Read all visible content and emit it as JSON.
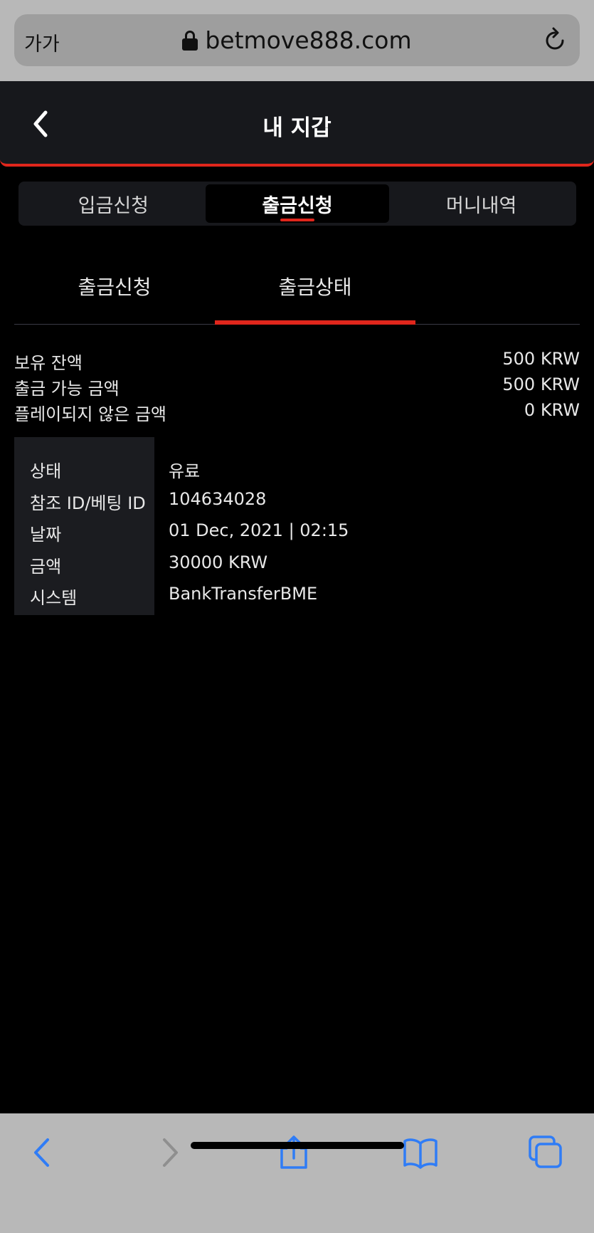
{
  "browser": {
    "text_size_label": "가가",
    "url": "betmove888.com"
  },
  "header": {
    "title": "내 지갑"
  },
  "main_tabs": [
    {
      "label": "입금신청",
      "active": false
    },
    {
      "label": "출금신청",
      "active": true
    },
    {
      "label": "머니내역",
      "active": false
    }
  ],
  "sub_tabs": [
    {
      "label": "출금신청",
      "active": false
    },
    {
      "label": "출금상태",
      "active": true
    }
  ],
  "balances": [
    {
      "label": "보유 잔액",
      "value": "500 KRW"
    },
    {
      "label": "출금 가능 금액",
      "value": "500 KRW"
    },
    {
      "label": "플레이되지 않은 금액",
      "value": "0 KRW"
    }
  ],
  "withdrawal": {
    "status_label": "상태",
    "status_value": "유료",
    "ref_label": "참조 ID/베팅 ID",
    "ref_value": "104634028",
    "date_label": "날짜",
    "date_value": "01 Dec, 2021 | 02:15",
    "amount_label": "금액",
    "amount_value": "30000 KRW",
    "system_label": "시스템",
    "system_value": "BankTransferBME"
  },
  "colors": {
    "accent": "#e0261c",
    "background": "#000000",
    "panel": "#17181c",
    "safari_blue": "#2f7cf6"
  },
  "icons": {
    "lock": "lock-icon",
    "reload": "reload-icon",
    "back": "chevron-left-icon",
    "share": "share-icon",
    "bookmarks": "book-icon",
    "tabs": "tabs-icon"
  }
}
